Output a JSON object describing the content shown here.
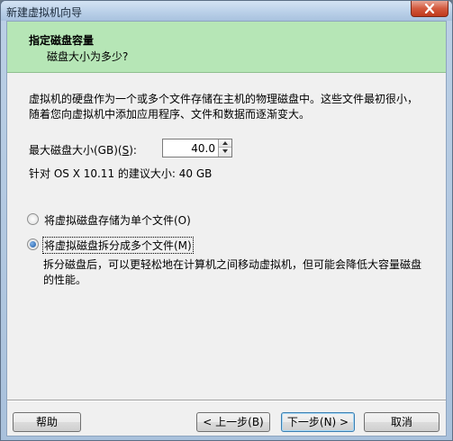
{
  "window": {
    "title": "新建虚拟机向导"
  },
  "header": {
    "title": "指定磁盘容量",
    "subtitle": "磁盘大小为多少?"
  },
  "content": {
    "description": "虚拟机的硬盘作为一个或多个文件存储在主机的物理磁盘中。这些文件最初很小，随着您向虚拟机中添加应用程序、文件和数据而逐渐变大。",
    "max_size_label_prefix": "最大磁盘大小(GB)(",
    "max_size_label_key": "S",
    "max_size_label_suffix": "):",
    "max_size_value": "40.0",
    "recommended": "针对 OS X 10.11 的建议大小: 40 GB",
    "options": [
      {
        "label": "将虚拟磁盘存储为单个文件(O)",
        "checked": false
      },
      {
        "label": "将虚拟磁盘拆分成多个文件(M)",
        "checked": true
      }
    ],
    "split_note": "拆分磁盘后，可以更轻松地在计算机之间移动虚拟机，但可能会降低大容量磁盘的性能。"
  },
  "footer": {
    "help": "帮助",
    "back": "< 上一步(B)",
    "next": "下一步(N) >",
    "cancel": "取消"
  },
  "colors": {
    "header_bg": "#b6e6b6",
    "client_bg": "#f0f0f0",
    "close_button": "#c0391c"
  }
}
